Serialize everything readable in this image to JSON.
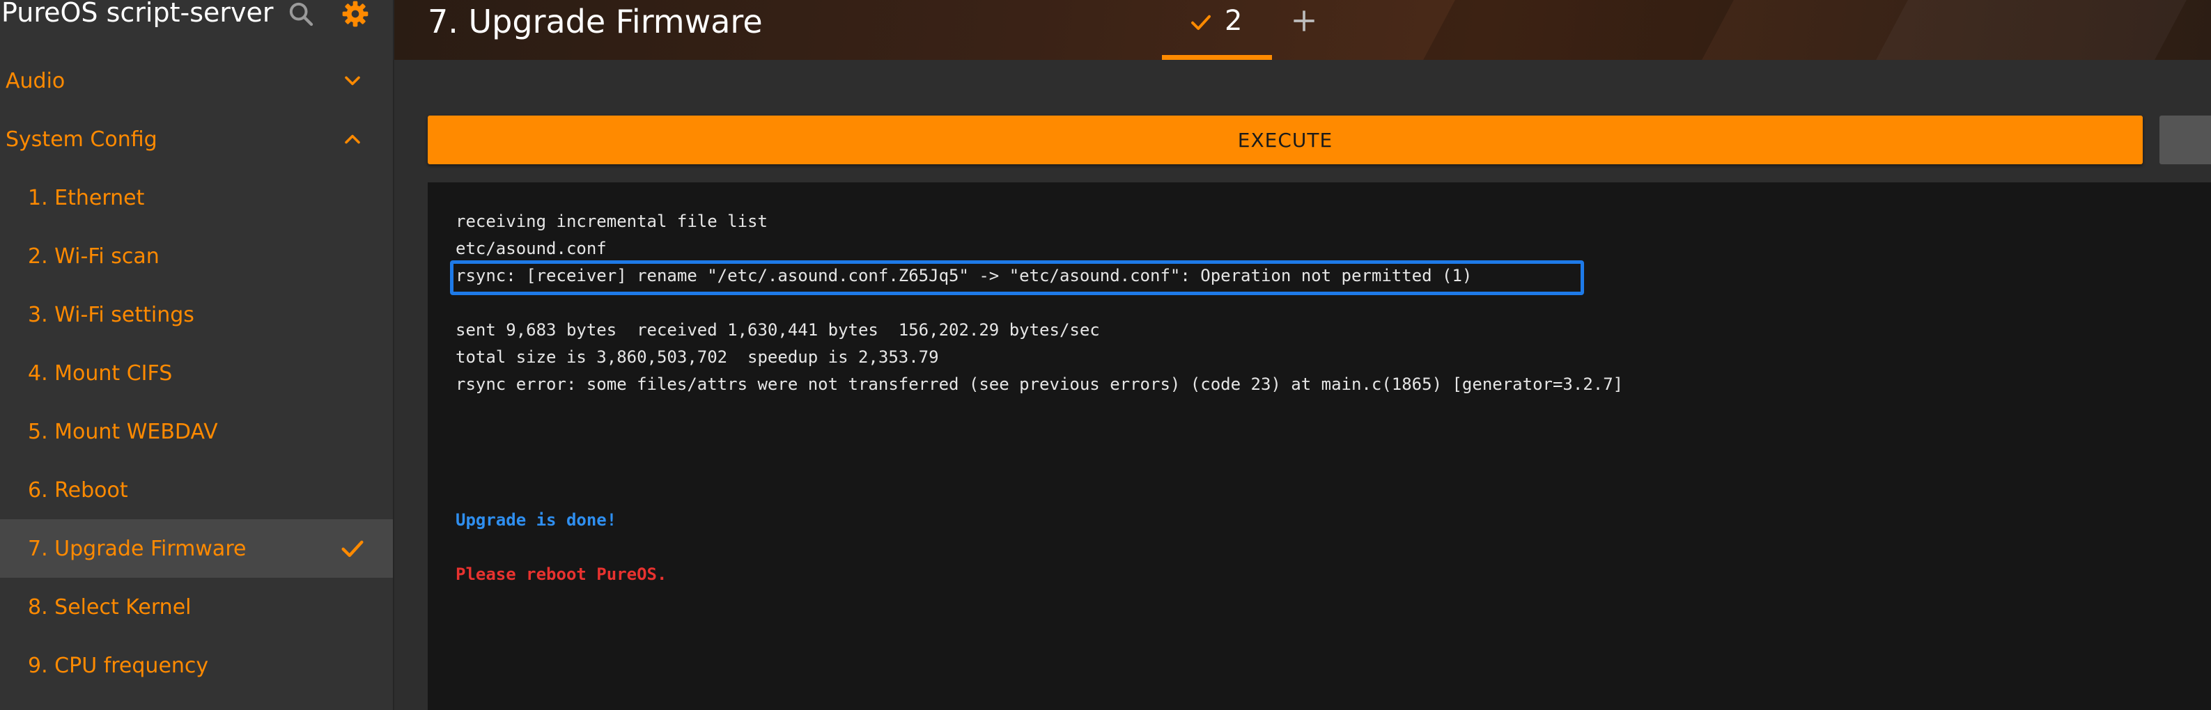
{
  "app": {
    "title": "PureOS script-server"
  },
  "colors": {
    "accent": "#ff8a00",
    "highlight": "#1e7ae8",
    "success": "#2f8ff0",
    "error": "#e8322f"
  },
  "header_icons": {
    "search": "search-icon",
    "settings": "gear-icon"
  },
  "sidebar": {
    "groups": [
      {
        "label": "Audio",
        "expanded": false
      },
      {
        "label": "System Config",
        "expanded": true
      }
    ],
    "items": [
      {
        "label": "1. Ethernet"
      },
      {
        "label": "2. Wi-Fi scan"
      },
      {
        "label": "3. Wi-Fi settings"
      },
      {
        "label": "4. Mount CIFS"
      },
      {
        "label": "5. Mount WEBDAV"
      },
      {
        "label": "6. Reboot"
      },
      {
        "label": "7. Upgrade Firmware",
        "active": true
      },
      {
        "label": "8. Select Kernel"
      },
      {
        "label": "9. CPU frequency"
      }
    ]
  },
  "main": {
    "title": "7. Upgrade Firmware",
    "execution_tab": {
      "count": "2"
    },
    "add_tab_label": "+",
    "execute_label": "EXECUTE",
    "log": {
      "lines": [
        "receiving incremental file list",
        "etc/asound.conf",
        "rsync: [receiver] rename \"/etc/.asound.conf.Z65Jq5\" -> \"etc/asound.conf\": Operation not permitted (1)",
        "sent 9,683 bytes  received 1,630,441 bytes  156,202.29 bytes/sec",
        "total size is 3,860,503,702  speedup is 2,353.79",
        "rsync error: some files/attrs were not transferred (see previous errors) (code 23) at main.c(1865) [generator=3.2.7]"
      ],
      "done_message": "Upgrade is done!",
      "reboot_message": "Please reboot PureOS."
    }
  }
}
